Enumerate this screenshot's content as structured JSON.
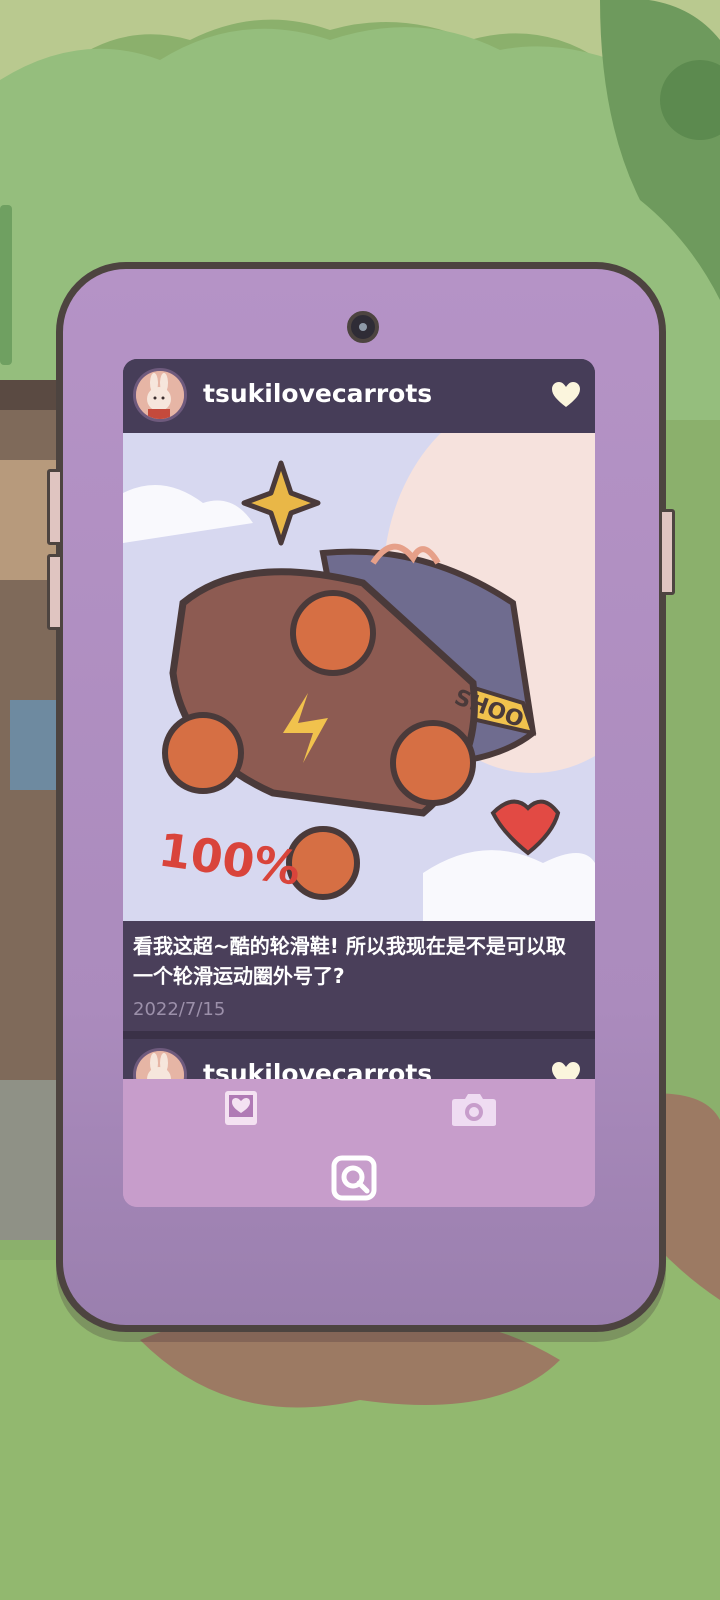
{
  "posts": [
    {
      "username": "tsukilovecarrots",
      "caption": "看我这超~酷的轮滑鞋! 所以我现在是不是可以取一个轮滑运动圈外号了?",
      "date": "2022/7/15",
      "image": {
        "badge_text": "100%",
        "ribbon_text": "SHOO"
      },
      "liked": true
    },
    {
      "username": "tsukilovecarrots",
      "liked": true
    }
  ],
  "nav": [
    {
      "name": "favorites",
      "icon": "heart-photo-icon"
    },
    {
      "name": "camera",
      "icon": "camera-icon"
    },
    {
      "name": "home",
      "icon": "search-frame-icon"
    }
  ],
  "colors": {
    "phone": "#b593c6",
    "header": "#463d58",
    "nav": "#c79dcb"
  }
}
